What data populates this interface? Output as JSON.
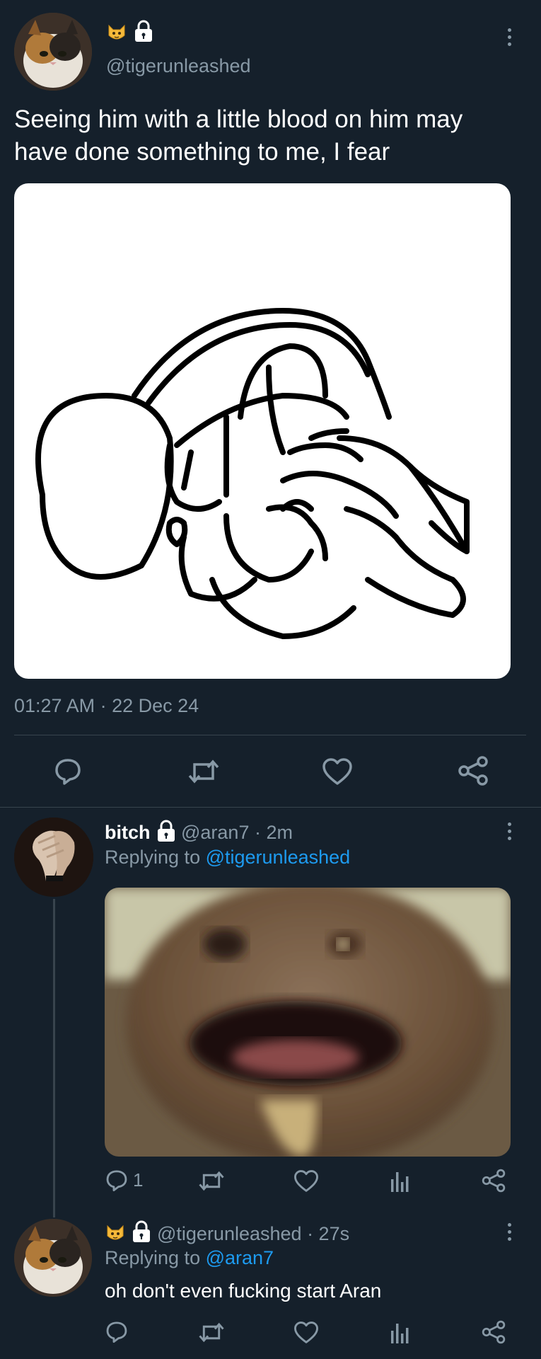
{
  "main_tweet": {
    "badges": [
      "cat-emoji",
      "lock-icon"
    ],
    "handle": "@tigerunleashed",
    "text_line1": "Seeing him with a little blood on him may",
    "text_line2": "have done something to me, I fear",
    "timestamp": "01:27 AM · 22 Dec 24",
    "actions": [
      "reply-icon",
      "retweet-icon",
      "like-icon",
      "share-icon"
    ]
  },
  "reply1": {
    "display_name": "bitch",
    "handle": "@aran7",
    "time": "· 2m",
    "replying_label": "Replying to",
    "replying_to": "@tigerunleashed",
    "reply_count": "1"
  },
  "reply2": {
    "handle": "@tigerunleashed",
    "time": "· 27s",
    "replying_label": "Replying to",
    "replying_to": "@aran7",
    "text": "oh don't even fucking start Aran"
  },
  "colors": {
    "background": "#15202b",
    "muted": "#8899a6",
    "link": "#1d9bf0",
    "divider": "#38444d"
  }
}
